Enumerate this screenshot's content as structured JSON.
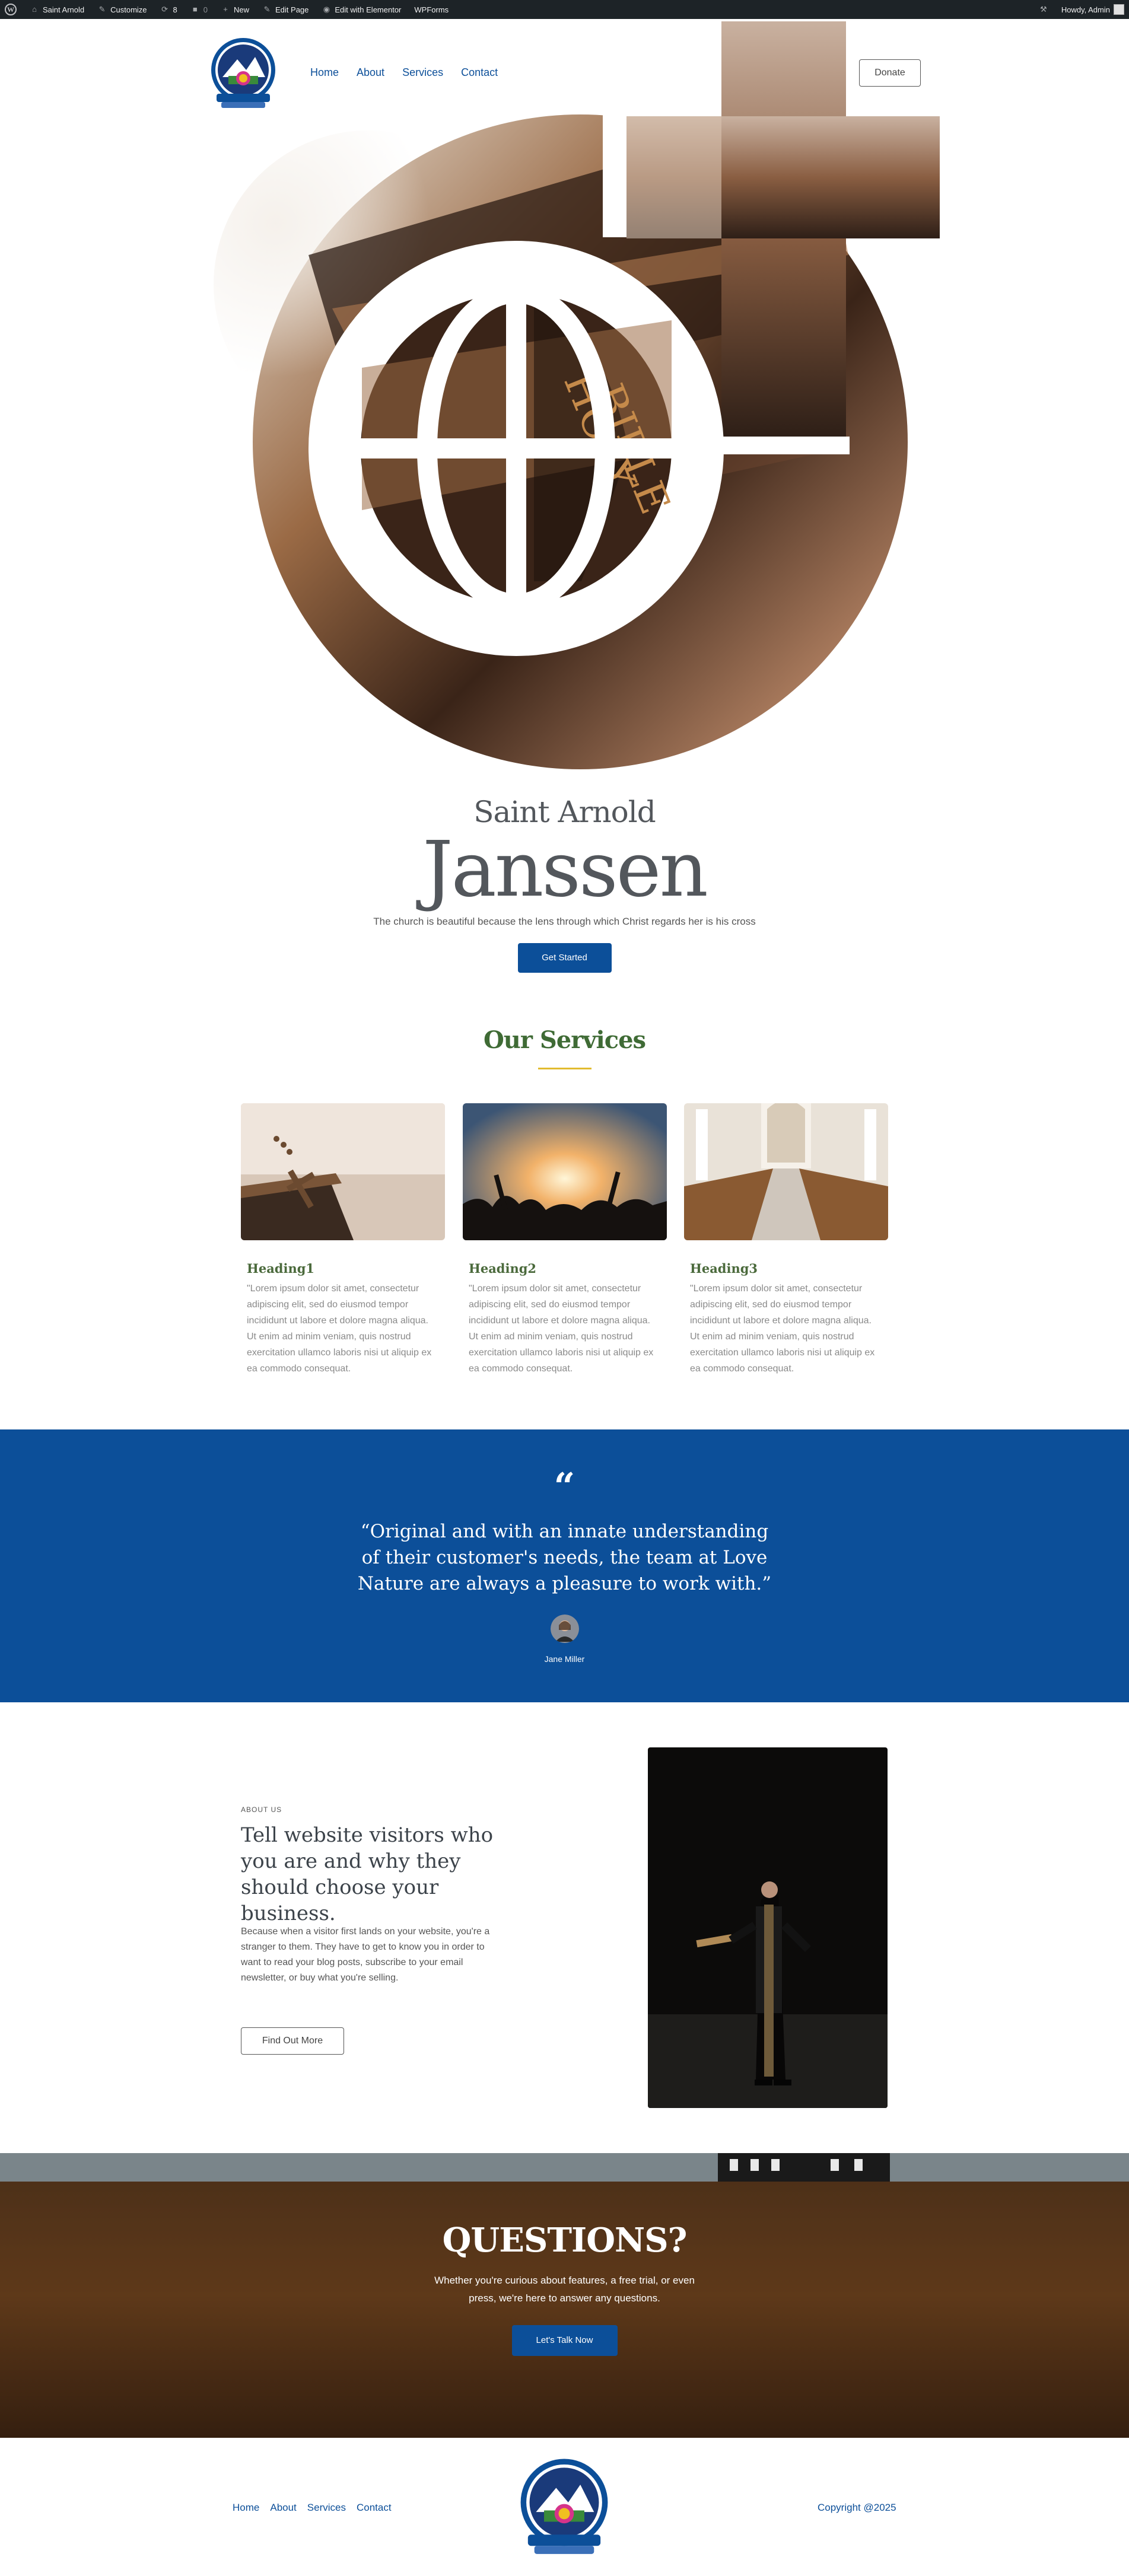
{
  "adminbar": {
    "site_name": "Saint Arnold",
    "customize": "Customize",
    "updates": "8",
    "comments": "0",
    "new": "New",
    "edit_page": "Edit Page",
    "edit_elementor": "Edit with Elementor",
    "wpforms": "WPForms",
    "howdy": "Howdy, Admin"
  },
  "nav": {
    "items": [
      "Home",
      "About",
      "Services",
      "Contact"
    ],
    "donate": "Donate"
  },
  "hero": {
    "subtitle": "Saint Arnold",
    "title": "Janssen",
    "description": "The church is beautiful because the lens through which Christ regards her is his cross",
    "button": "Get Started"
  },
  "services": {
    "title": "Our Services",
    "cards": [
      {
        "heading": "Heading1",
        "text": "\"Lorem ipsum dolor sit amet, consectetur adipiscing elit, sed do eiusmod tempor incididunt ut labore et dolore magna aliqua. Ut enim ad minim veniam, quis nostrud exercitation ullamco laboris nisi ut aliquip ex ea commodo consequat."
      },
      {
        "heading": "Heading2",
        "text": "\"Lorem ipsum dolor sit amet, consectetur adipiscing elit, sed do eiusmod tempor incididunt ut labore et dolore magna aliqua. Ut enim ad minim veniam, quis nostrud exercitation ullamco laboris nisi ut aliquip ex ea commodo consequat."
      },
      {
        "heading": "Heading3",
        "text": "\"Lorem ipsum dolor sit amet, consectetur adipiscing elit, sed do eiusmod tempor incididunt ut labore et dolore magna aliqua. Ut enim ad minim veniam, quis nostrud exercitation ullamco laboris nisi ut aliquip ex ea commodo consequat."
      }
    ]
  },
  "testimonial": {
    "mark": "“",
    "quote": "“Original and with an innate understanding of their customer's needs, the team at Love Nature are always a pleasure to work with.”",
    "name": "Jane Miller"
  },
  "about": {
    "label": "ABOUT US",
    "title": "Tell website visitors who you are and why they should choose your business.",
    "text": "Because when a visitor first lands on your website, you're a stranger to them. They have to get to know you in order to want to read your blog posts, subscribe to your email newsletter, or buy what you're selling.",
    "button": "Find Out More"
  },
  "questions": {
    "title": "QUESTIONS?",
    "text": "Whether you're curious about features, a free trial, or even press, we're here to answer any questions.",
    "button": "Let's Talk Now"
  },
  "footer": {
    "nav": [
      "Home",
      "About",
      "Services",
      "Contact"
    ],
    "copyright": "Copyright @2025"
  },
  "colors": {
    "brand_blue": "#0c4f99",
    "services_green": "#3f6b35",
    "accent_gold": "#e2bb2f",
    "admin_bar": "#1d2327"
  }
}
